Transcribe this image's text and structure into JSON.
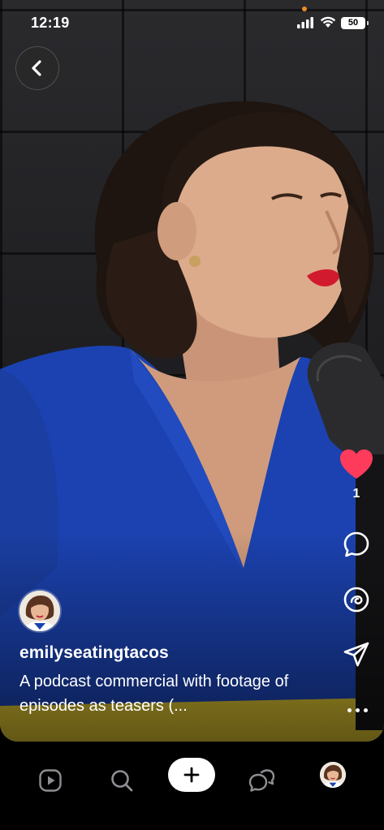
{
  "status_bar": {
    "time": "12:19",
    "battery": "50"
  },
  "post": {
    "username": "emilyseatingtacos",
    "caption": "A podcast commercial with footage of episodes as teasers (...",
    "like_count": "1"
  },
  "icons": {
    "back": "chevron-left-icon",
    "like": "heart-icon",
    "comment": "speech-bubble-icon",
    "remix": "remix-icon",
    "share": "paper-plane-icon",
    "more": "more-dots-icon",
    "nav_home": "play-square-icon",
    "nav_search": "search-icon",
    "nav_create": "plus-icon",
    "nav_messages": "chat-bubbles-icon"
  },
  "colors": {
    "like": "#ff3b5c",
    "accent_dot": "#f08a24"
  }
}
